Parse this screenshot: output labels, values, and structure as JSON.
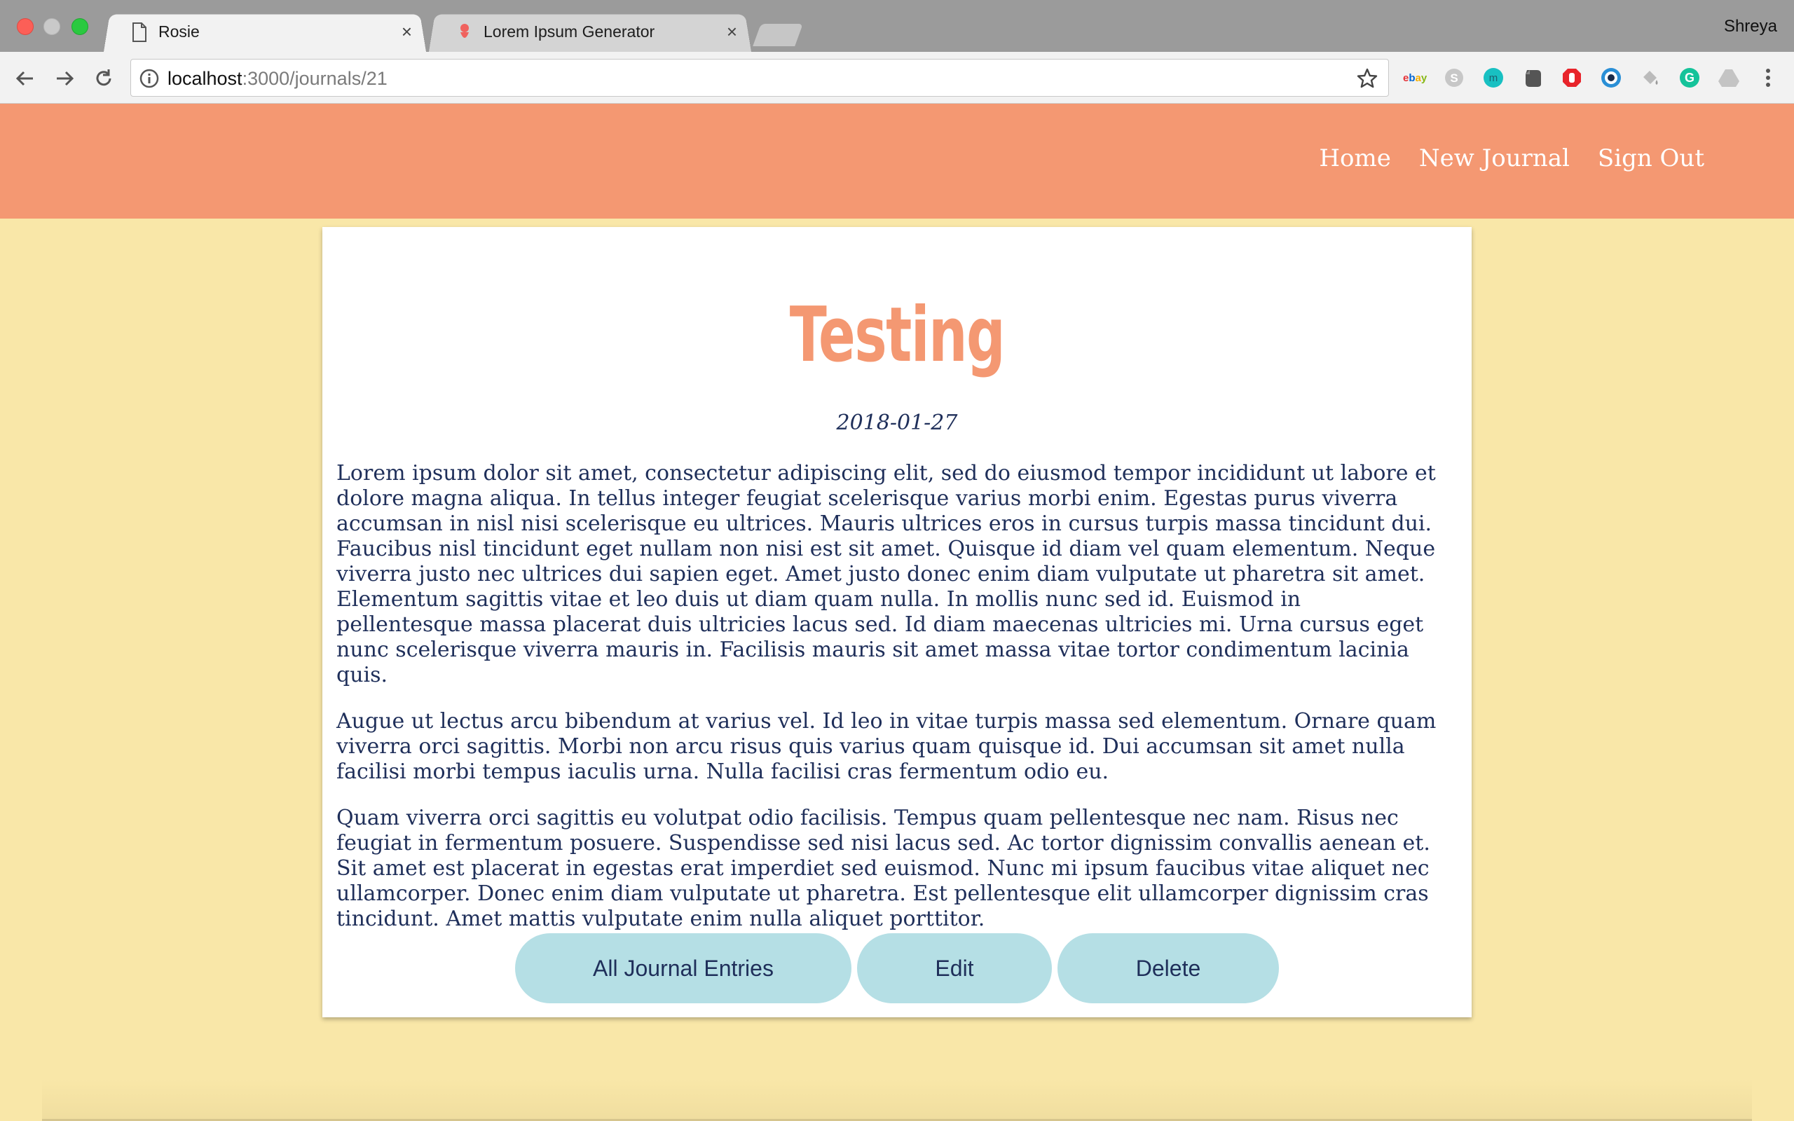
{
  "browser": {
    "tabs": [
      {
        "title": "Rosie",
        "icon": "document-icon",
        "active": true
      },
      {
        "title": "Lorem Ipsum Generator",
        "icon": "lorem-ipsum-favicon",
        "active": false
      }
    ],
    "profile_name": "Shreya",
    "url_host": "localhost",
    "url_path": ":3000/journals/21",
    "extensions": [
      "ebay-icon",
      "skype-icon",
      "m-icon",
      "evernote-icon",
      "adblock-icon",
      "eye-icon",
      "paint-bucket-icon",
      "grammarly-icon",
      "drive-icon"
    ]
  },
  "site_nav": {
    "home": "Home",
    "new_journal": "New Journal",
    "sign_out": "Sign Out"
  },
  "journal": {
    "title": "Testing",
    "date": "2018-01-27",
    "paragraphs": [
      "Lorem ipsum dolor sit amet, consectetur adipiscing elit, sed do eiusmod tempor incididunt ut labore et dolore magna aliqua. In tellus integer feugiat scelerisque varius morbi enim. Egestas purus viverra accumsan in nisl nisi scelerisque eu ultrices. Mauris ultrices eros in cursus turpis massa tincidunt dui. Faucibus nisl tincidunt eget nullam non nisi est sit amet. Quisque id diam vel quam elementum. Neque viverra justo nec ultrices dui sapien eget. Amet justo donec enim diam vulputate ut pharetra sit amet. Elementum sagittis vitae et leo duis ut diam quam nulla. In mollis nunc sed id. Euismod in pellentesque massa placerat duis ultricies lacus sed. Id diam maecenas ultricies mi. Urna cursus eget nunc scelerisque viverra mauris in. Facilisis mauris sit amet massa vitae tortor condimentum lacinia quis.",
      "Augue ut lectus arcu bibendum at varius vel. Id leo in vitae turpis massa sed elementum. Ornare quam viverra orci sagittis. Morbi non arcu risus quis varius quam quisque id. Dui accumsan sit amet nulla facilisi morbi tempus iaculis urna. Nulla facilisi cras fermentum odio eu.",
      "Quam viverra orci sagittis eu volutpat odio facilisis. Tempus quam pellentesque nec nam. Risus nec feugiat in fermentum posuere. Suspendisse sed nisi lacus sed. Ac tortor dignissim convallis aenean et. Sit amet est placerat in egestas erat imperdiet sed euismod. Nunc mi ipsum faucibus vitae aliquet nec ullamcorper. Donec enim diam vulputate ut pharetra. Est pellentesque elit ullamcorper dignissim cras tincidunt. Amet mattis vulputate enim nulla aliquet porttitor."
    ],
    "buttons": {
      "all_entries": "All Journal Entries",
      "edit": "Edit",
      "delete": "Delete"
    }
  },
  "colors": {
    "header": "#f49872",
    "background": "#f9e7a8",
    "button": "#b5dfe5",
    "text": "#1f2f5a"
  }
}
